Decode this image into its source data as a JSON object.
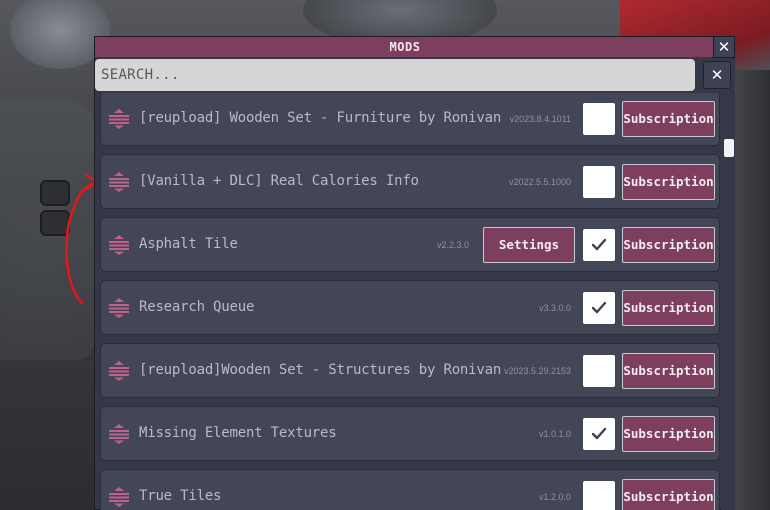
{
  "dialog": {
    "title": "MODS",
    "close_icon": "close-icon",
    "search": {
      "placeholder": "SEARCH...",
      "clear_icon": "close-icon"
    }
  },
  "colors": {
    "accent": "#7d3f5d",
    "panel": "#353847",
    "row": "#434657",
    "text": "#b8bac8"
  },
  "mods": [
    {
      "name": "[reupload] Wooden Set - Furniture by Ronivan",
      "version": "v2023.8.4.1011",
      "enabled": false,
      "has_settings": false,
      "button_label": "Subscription"
    },
    {
      "name": "[Vanilla + DLC] Real Calories Info",
      "version": "v2022.5.5.1000",
      "enabled": false,
      "has_settings": false,
      "button_label": "Subscription"
    },
    {
      "name": "Asphalt Tile",
      "version": "v2.2.3.0",
      "enabled": true,
      "has_settings": true,
      "settings_label": "Settings",
      "button_label": "Subscription"
    },
    {
      "name": "Research Queue",
      "version": "v3.3.0.0",
      "enabled": true,
      "has_settings": false,
      "button_label": "Subscription"
    },
    {
      "name": "[reupload]Wooden Set - Structures by Ronivan",
      "version": "v2023.5.29.2153",
      "enabled": false,
      "has_settings": false,
      "button_label": "Subscription"
    },
    {
      "name": "Missing Element Textures",
      "version": "v1.0.1.0",
      "enabled": true,
      "has_settings": false,
      "button_label": "Subscription"
    },
    {
      "name": "True Tiles",
      "version": "v1.2.0.0",
      "enabled": false,
      "has_settings": false,
      "button_label": "Subscription"
    }
  ]
}
